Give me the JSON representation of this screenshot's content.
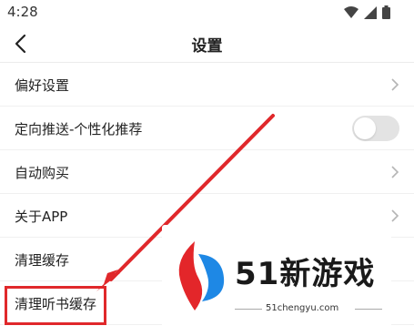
{
  "status_bar": {
    "time": "4:28",
    "icons": [
      "wifi-icon",
      "signal-icon",
      "battery-icon"
    ]
  },
  "header": {
    "title": "设置",
    "back_icon": "chevron-left-icon"
  },
  "settings": {
    "items": [
      {
        "label": "偏好设置",
        "control": "chevron"
      },
      {
        "label": "定向推送-个性化推荐",
        "control": "toggle",
        "toggle_on": false
      },
      {
        "label": "自动购买",
        "control": "chevron"
      },
      {
        "label": "关于APP",
        "control": "chevron"
      },
      {
        "label": "清理缓存",
        "control": "none"
      },
      {
        "label": "清理听书缓存",
        "control": "none",
        "highlighted": true
      }
    ]
  },
  "annotation": {
    "color": "#e0282b",
    "arrow_target": "清理听书缓存"
  },
  "watermark": {
    "brand_text": "51新游戏",
    "url": "51chengyu.com"
  },
  "colors": {
    "toggle_off": "#e3e3e3",
    "chevron": "#b5b5b5",
    "divider": "#f0f0f0"
  }
}
